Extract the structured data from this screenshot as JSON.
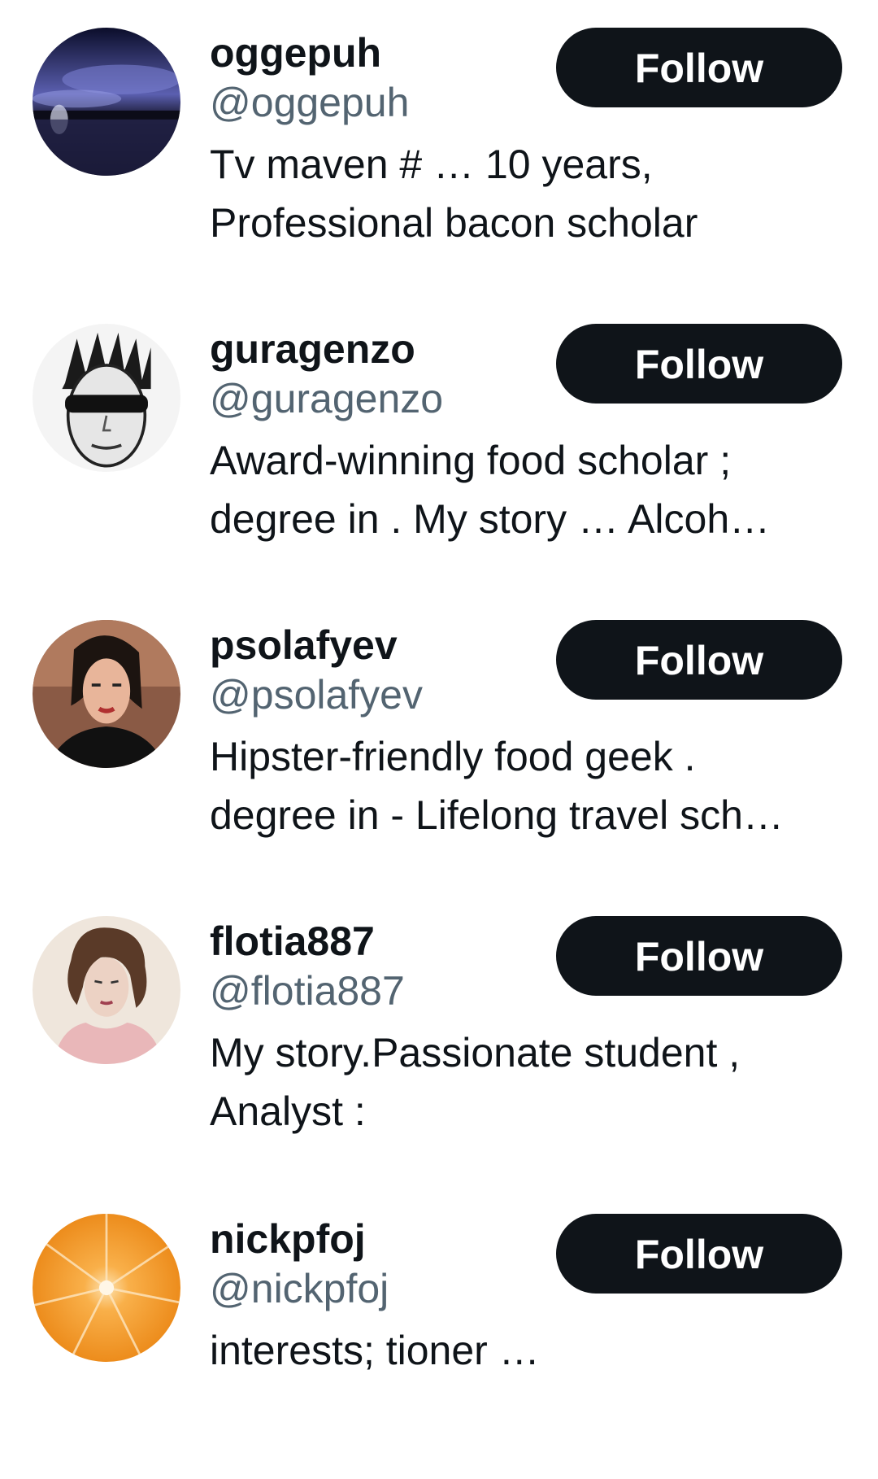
{
  "users": [
    {
      "name": "oggepuh",
      "handle": "@oggepuh",
      "bio_line1": "Tv maven  #   …  10 years,",
      "bio_line2": "Professional bacon scholar",
      "follow_label": "Follow",
      "avatar_icon": "night-lake-photo"
    },
    {
      "name": "guragenzo",
      "handle": "@guragenzo",
      "bio_line1": "Award-winning food scholar ;",
      "bio_line2": "degree in . My story … Alcoh…",
      "follow_label": "Follow",
      "avatar_icon": "punk-sunglasses-drawing"
    },
    {
      "name": "psolafyev",
      "handle": "@psolafyev",
      "bio_line1": "Hipster-friendly food geek   .",
      "bio_line2": "degree in - Lifelong travel sch…",
      "follow_label": "Follow",
      "avatar_icon": "woman-illustration"
    },
    {
      "name": "flotia887",
      "handle": "@flotia887",
      "bio_line1": "My story.Passionate student ,",
      "bio_line2": "Analyst :",
      "follow_label": "Follow",
      "avatar_icon": "vintage-doll-photo"
    },
    {
      "name": "nickpfoj",
      "handle": "@nickpfoj",
      "bio_line1": "interests; tioner  …",
      "bio_line2": "",
      "follow_label": "Follow",
      "avatar_icon": "orange-slice-photo"
    }
  ],
  "colors": {
    "button_bg": "#0f1419",
    "button_text": "#ffffff",
    "name_text": "#0f1419",
    "handle_text": "#536471"
  }
}
